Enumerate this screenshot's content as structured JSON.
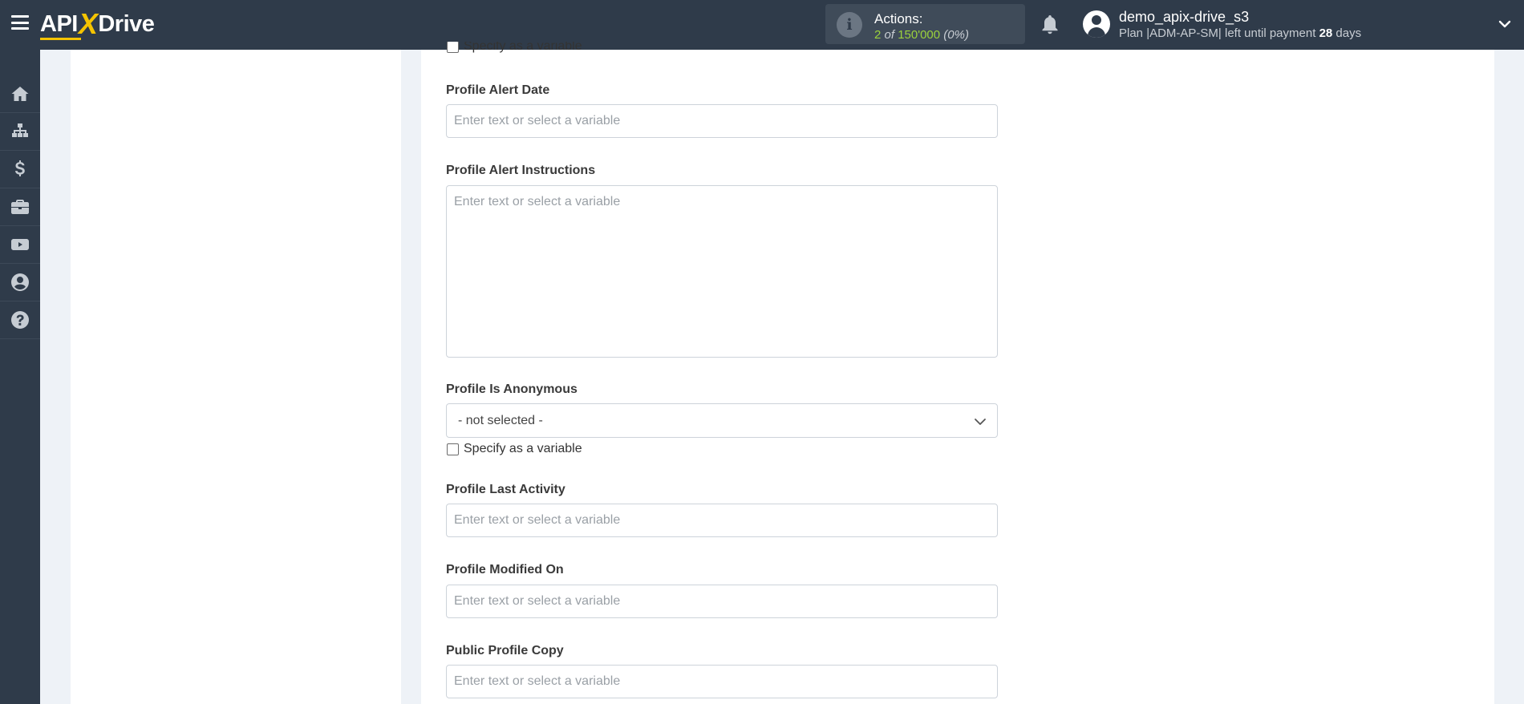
{
  "header": {
    "logo_left": "API",
    "logo_x": "X",
    "logo_right": "Drive",
    "actions_label": "Actions:",
    "actions_used": "2",
    "actions_of": "of",
    "actions_total": "150'000",
    "actions_percent": "(0%)",
    "username": "demo_apix-drive_s3",
    "plan_prefix": "Plan |ADM-AP-SM| left until payment",
    "plan_days": "28",
    "plan_suffix": "days"
  },
  "sidebar": {
    "items": [
      {
        "icon": "home-icon"
      },
      {
        "icon": "sitemap-icon"
      },
      {
        "icon": "dollar-icon"
      },
      {
        "icon": "briefcase-icon"
      },
      {
        "icon": "youtube-icon"
      },
      {
        "icon": "user-circle-icon"
      },
      {
        "icon": "help-icon"
      }
    ]
  },
  "form": {
    "specify_label": "Specify as a variable",
    "placeholder": "Enter text or select a variable",
    "fields": {
      "alert_date": {
        "label": "Profile Alert Date"
      },
      "alert_instructions": {
        "label": "Profile Alert Instructions"
      },
      "is_anonymous": {
        "label": "Profile Is Anonymous",
        "value": "- not selected -"
      },
      "last_activity": {
        "label": "Profile Last Activity"
      },
      "modified_on": {
        "label": "Profile Modified On"
      },
      "public_profile_copy": {
        "label": "Public Profile Copy"
      }
    }
  },
  "colors": {
    "topbar": "#2f3b4a",
    "accent_yellow": "#f5c400",
    "actions_green": "#9bd23c",
    "page_bg": "#eef2f7"
  }
}
